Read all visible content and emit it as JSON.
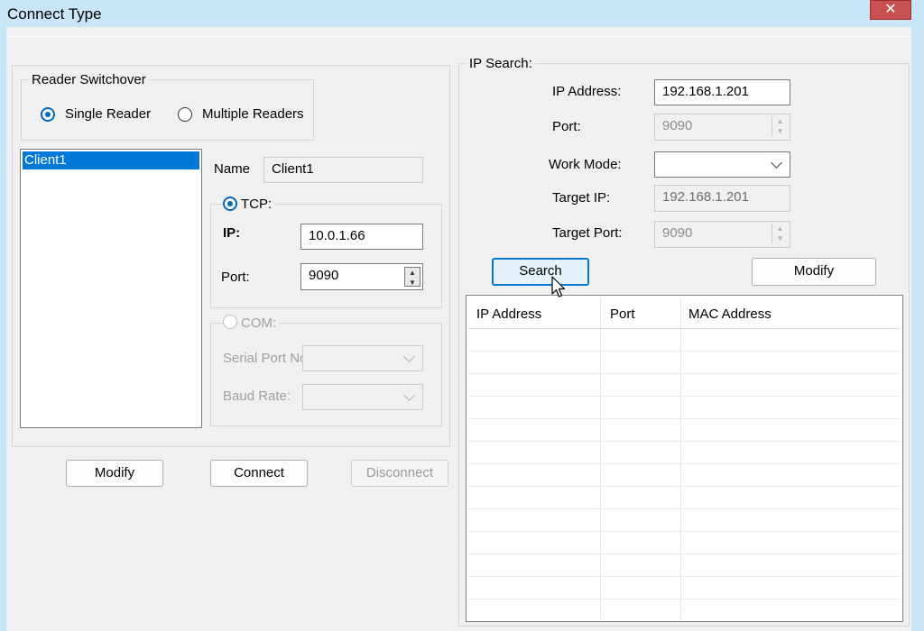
{
  "window": {
    "title": "Connect Type",
    "close_label": "✕"
  },
  "reader_switchover": {
    "legend": "Reader Switchover",
    "single_label": "Single Reader",
    "multiple_label": "Multiple Readers",
    "selected": "single"
  },
  "clients": {
    "items": [
      "Client1"
    ],
    "selected_index": 0
  },
  "client_settings": {
    "name_label": "Name",
    "name_value": "Client1",
    "tcp_legend": "TCP:",
    "ip_label": "IP:",
    "ip_value": "10.0.1.66",
    "port_label": "Port:",
    "port_value": "9090",
    "com_legend": "COM:",
    "serial_port_label": "Serial Port No",
    "baud_rate_label": "Baud Rate:"
  },
  "left_buttons": {
    "modify": "Modify",
    "connect": "Connect",
    "disconnect": "Disconnect"
  },
  "ip_search": {
    "legend": "IP Search:",
    "ip_address_label": "IP Address:",
    "ip_address_value": "192.168.1.201",
    "port_label": "Port:",
    "port_value": "9090",
    "work_mode_label": "Work Mode:",
    "work_mode_value": "",
    "target_ip_label": "Target IP:",
    "target_ip_value": "192.168.1.201",
    "target_port_label": "Target Port:",
    "target_port_value": "9090",
    "search_button": "Search",
    "modify_button": "Modify"
  },
  "results_table": {
    "columns": [
      "IP Address",
      "Port",
      "MAC Address"
    ],
    "rows": []
  },
  "icons": {
    "spin_up": "▲",
    "spin_down": "▼",
    "close": "close-icon",
    "cursor": "pointer-cursor-icon"
  },
  "colors": {
    "accent": "#0078d7",
    "title_bar": "#c9e6f8",
    "close_button": "#c75050"
  }
}
